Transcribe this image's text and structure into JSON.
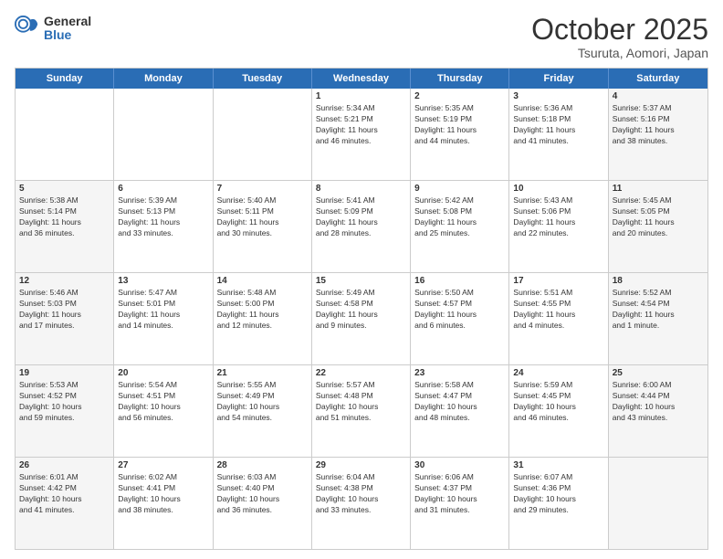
{
  "logo": {
    "general": "General",
    "blue": "Blue"
  },
  "header": {
    "month": "October 2025",
    "location": "Tsuruta, Aomori, Japan"
  },
  "weekdays": [
    "Sunday",
    "Monday",
    "Tuesday",
    "Wednesday",
    "Thursday",
    "Friday",
    "Saturday"
  ],
  "rows": [
    [
      {
        "day": "",
        "text": "",
        "shaded": false
      },
      {
        "day": "",
        "text": "",
        "shaded": false
      },
      {
        "day": "",
        "text": "",
        "shaded": false
      },
      {
        "day": "1",
        "text": "Sunrise: 5:34 AM\nSunset: 5:21 PM\nDaylight: 11 hours\nand 46 minutes.",
        "shaded": false
      },
      {
        "day": "2",
        "text": "Sunrise: 5:35 AM\nSunset: 5:19 PM\nDaylight: 11 hours\nand 44 minutes.",
        "shaded": false
      },
      {
        "day": "3",
        "text": "Sunrise: 5:36 AM\nSunset: 5:18 PM\nDaylight: 11 hours\nand 41 minutes.",
        "shaded": false
      },
      {
        "day": "4",
        "text": "Sunrise: 5:37 AM\nSunset: 5:16 PM\nDaylight: 11 hours\nand 38 minutes.",
        "shaded": true
      }
    ],
    [
      {
        "day": "5",
        "text": "Sunrise: 5:38 AM\nSunset: 5:14 PM\nDaylight: 11 hours\nand 36 minutes.",
        "shaded": true
      },
      {
        "day": "6",
        "text": "Sunrise: 5:39 AM\nSunset: 5:13 PM\nDaylight: 11 hours\nand 33 minutes.",
        "shaded": false
      },
      {
        "day": "7",
        "text": "Sunrise: 5:40 AM\nSunset: 5:11 PM\nDaylight: 11 hours\nand 30 minutes.",
        "shaded": false
      },
      {
        "day": "8",
        "text": "Sunrise: 5:41 AM\nSunset: 5:09 PM\nDaylight: 11 hours\nand 28 minutes.",
        "shaded": false
      },
      {
        "day": "9",
        "text": "Sunrise: 5:42 AM\nSunset: 5:08 PM\nDaylight: 11 hours\nand 25 minutes.",
        "shaded": false
      },
      {
        "day": "10",
        "text": "Sunrise: 5:43 AM\nSunset: 5:06 PM\nDaylight: 11 hours\nand 22 minutes.",
        "shaded": false
      },
      {
        "day": "11",
        "text": "Sunrise: 5:45 AM\nSunset: 5:05 PM\nDaylight: 11 hours\nand 20 minutes.",
        "shaded": true
      }
    ],
    [
      {
        "day": "12",
        "text": "Sunrise: 5:46 AM\nSunset: 5:03 PM\nDaylight: 11 hours\nand 17 minutes.",
        "shaded": true
      },
      {
        "day": "13",
        "text": "Sunrise: 5:47 AM\nSunset: 5:01 PM\nDaylight: 11 hours\nand 14 minutes.",
        "shaded": false
      },
      {
        "day": "14",
        "text": "Sunrise: 5:48 AM\nSunset: 5:00 PM\nDaylight: 11 hours\nand 12 minutes.",
        "shaded": false
      },
      {
        "day": "15",
        "text": "Sunrise: 5:49 AM\nSunset: 4:58 PM\nDaylight: 11 hours\nand 9 minutes.",
        "shaded": false
      },
      {
        "day": "16",
        "text": "Sunrise: 5:50 AM\nSunset: 4:57 PM\nDaylight: 11 hours\nand 6 minutes.",
        "shaded": false
      },
      {
        "day": "17",
        "text": "Sunrise: 5:51 AM\nSunset: 4:55 PM\nDaylight: 11 hours\nand 4 minutes.",
        "shaded": false
      },
      {
        "day": "18",
        "text": "Sunrise: 5:52 AM\nSunset: 4:54 PM\nDaylight: 11 hours\nand 1 minute.",
        "shaded": true
      }
    ],
    [
      {
        "day": "19",
        "text": "Sunrise: 5:53 AM\nSunset: 4:52 PM\nDaylight: 10 hours\nand 59 minutes.",
        "shaded": true
      },
      {
        "day": "20",
        "text": "Sunrise: 5:54 AM\nSunset: 4:51 PM\nDaylight: 10 hours\nand 56 minutes.",
        "shaded": false
      },
      {
        "day": "21",
        "text": "Sunrise: 5:55 AM\nSunset: 4:49 PM\nDaylight: 10 hours\nand 54 minutes.",
        "shaded": false
      },
      {
        "day": "22",
        "text": "Sunrise: 5:57 AM\nSunset: 4:48 PM\nDaylight: 10 hours\nand 51 minutes.",
        "shaded": false
      },
      {
        "day": "23",
        "text": "Sunrise: 5:58 AM\nSunset: 4:47 PM\nDaylight: 10 hours\nand 48 minutes.",
        "shaded": false
      },
      {
        "day": "24",
        "text": "Sunrise: 5:59 AM\nSunset: 4:45 PM\nDaylight: 10 hours\nand 46 minutes.",
        "shaded": false
      },
      {
        "day": "25",
        "text": "Sunrise: 6:00 AM\nSunset: 4:44 PM\nDaylight: 10 hours\nand 43 minutes.",
        "shaded": true
      }
    ],
    [
      {
        "day": "26",
        "text": "Sunrise: 6:01 AM\nSunset: 4:42 PM\nDaylight: 10 hours\nand 41 minutes.",
        "shaded": true
      },
      {
        "day": "27",
        "text": "Sunrise: 6:02 AM\nSunset: 4:41 PM\nDaylight: 10 hours\nand 38 minutes.",
        "shaded": false
      },
      {
        "day": "28",
        "text": "Sunrise: 6:03 AM\nSunset: 4:40 PM\nDaylight: 10 hours\nand 36 minutes.",
        "shaded": false
      },
      {
        "day": "29",
        "text": "Sunrise: 6:04 AM\nSunset: 4:38 PM\nDaylight: 10 hours\nand 33 minutes.",
        "shaded": false
      },
      {
        "day": "30",
        "text": "Sunrise: 6:06 AM\nSunset: 4:37 PM\nDaylight: 10 hours\nand 31 minutes.",
        "shaded": false
      },
      {
        "day": "31",
        "text": "Sunrise: 6:07 AM\nSunset: 4:36 PM\nDaylight: 10 hours\nand 29 minutes.",
        "shaded": false
      },
      {
        "day": "",
        "text": "",
        "shaded": true
      }
    ]
  ]
}
